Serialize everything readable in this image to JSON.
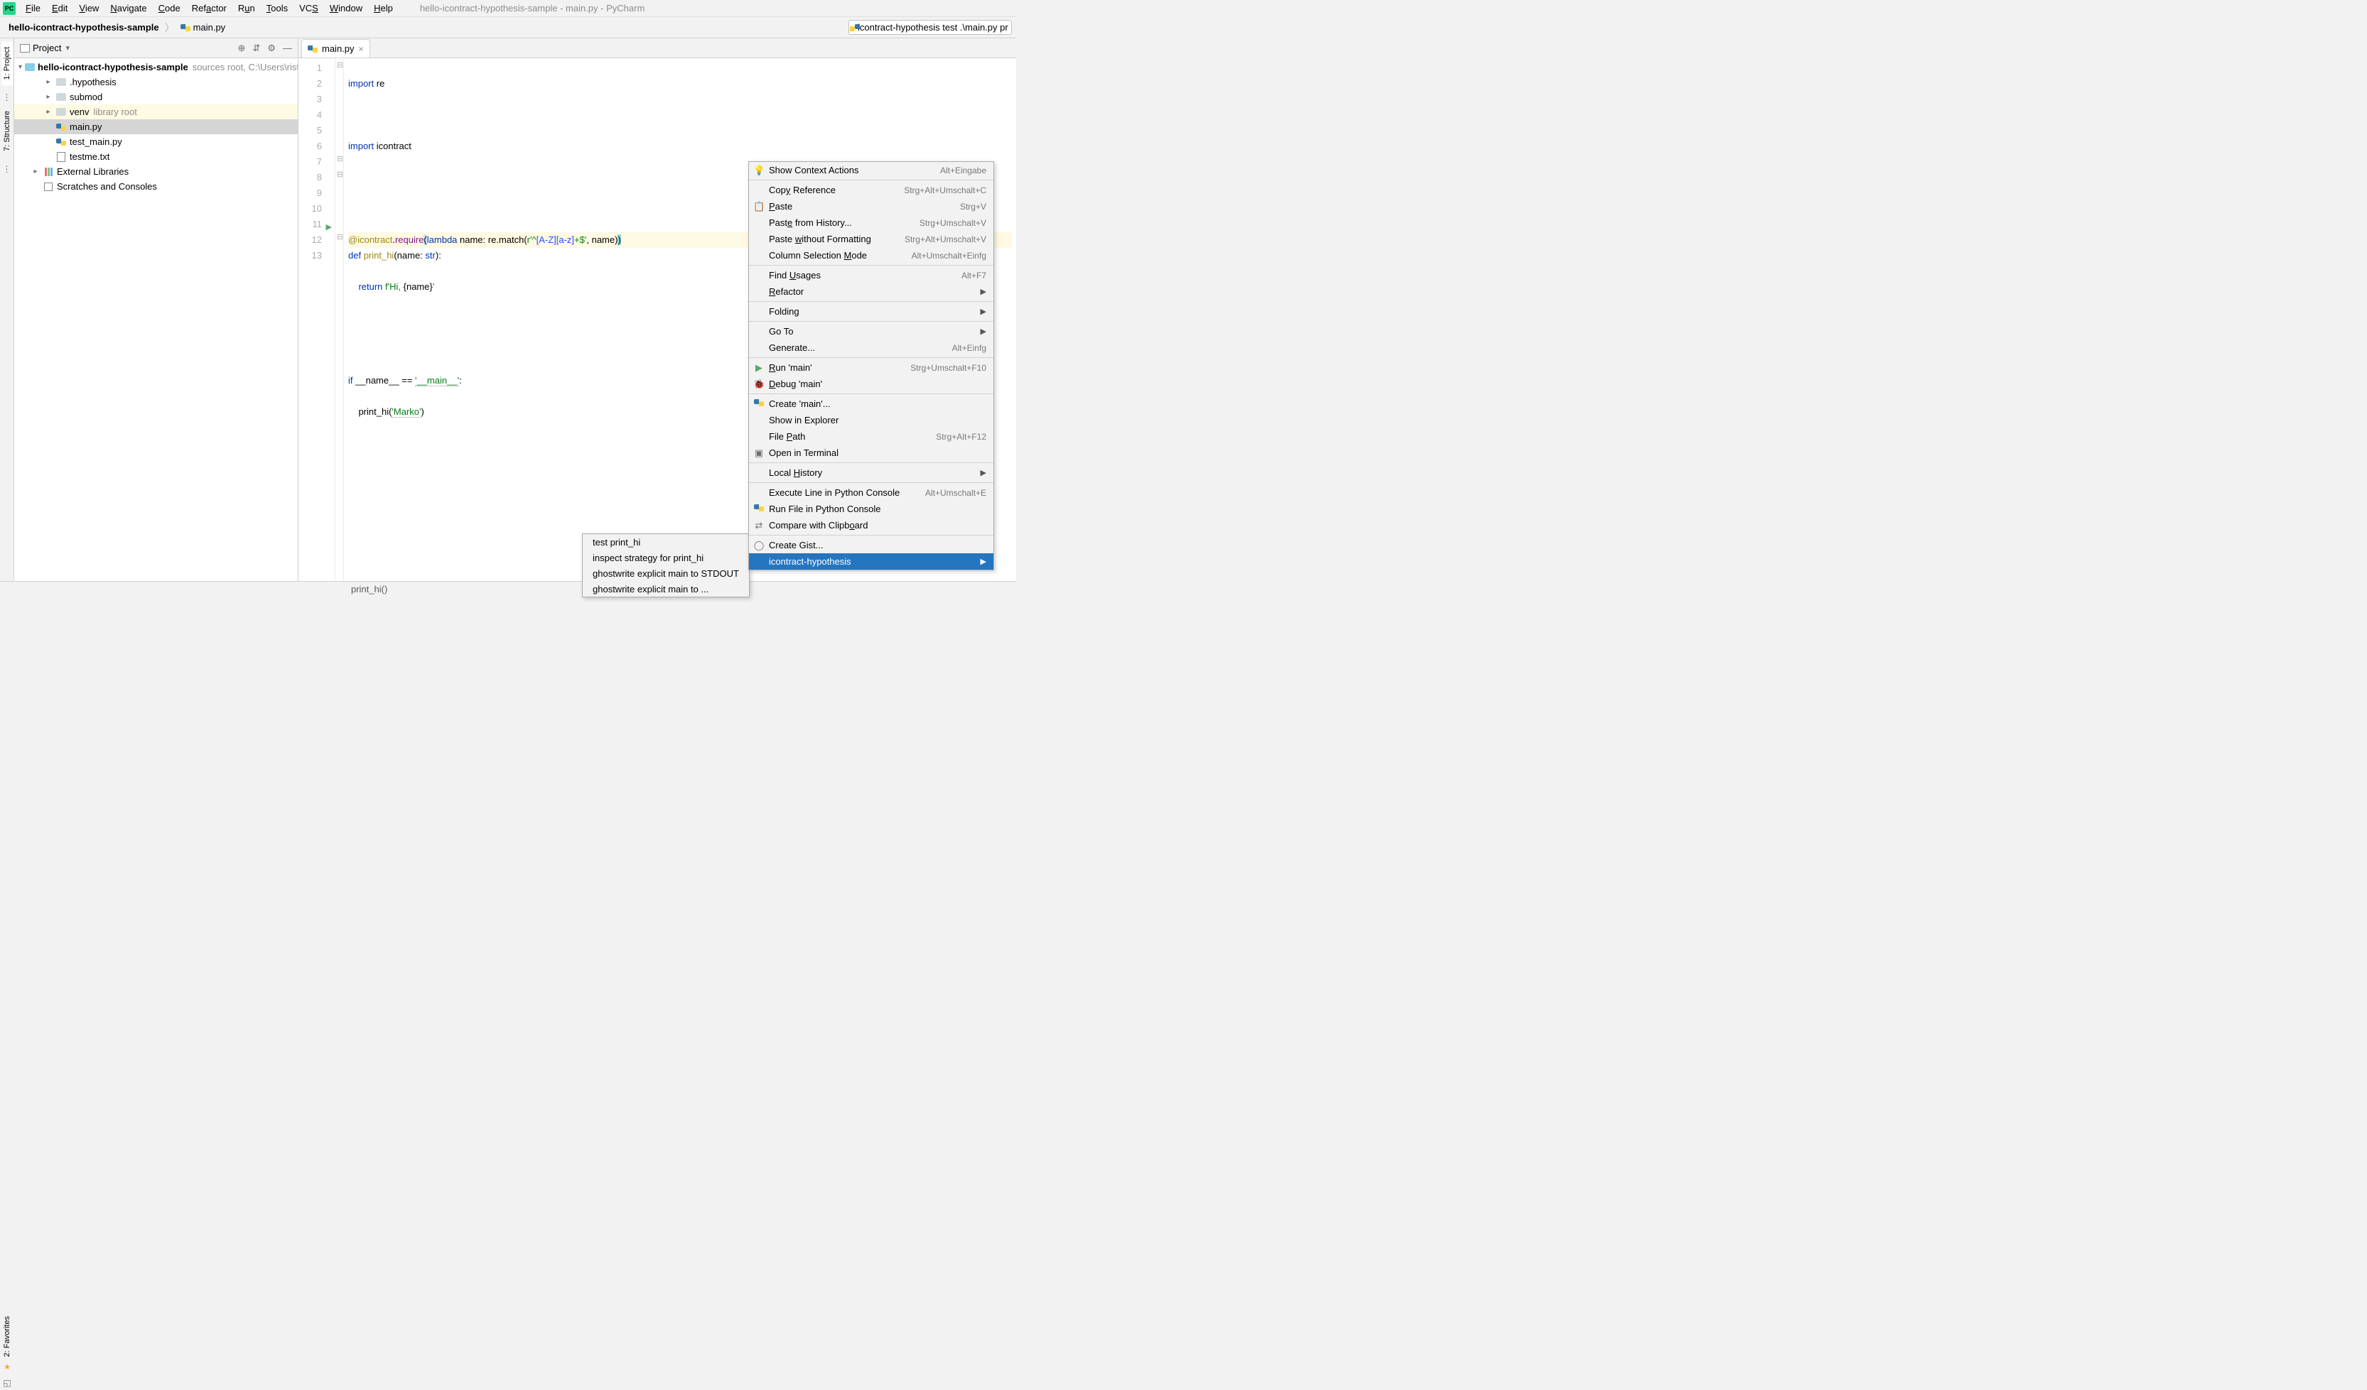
{
  "menubar": {
    "items": [
      "File",
      "Edit",
      "View",
      "Navigate",
      "Code",
      "Refactor",
      "Run",
      "Tools",
      "VCS",
      "Window",
      "Help"
    ],
    "underlines": [
      0,
      0,
      0,
      0,
      0,
      3,
      1,
      0,
      2,
      0,
      0
    ],
    "title": "hello-icontract-hypothesis-sample - main.py - PyCharm"
  },
  "breadcrumb": {
    "project": "hello-icontract-hypothesis-sample",
    "file": "main.py",
    "runconfig": "icontract-hypothesis test .\\main.py pr"
  },
  "left_tabs": {
    "project": "1: Project",
    "structure": "7: Structure",
    "favorites": "2: Favorites"
  },
  "project_panel": {
    "title": "Project",
    "root": "hello-icontract-hypothesis-sample",
    "root_meta": "sources root,  C:\\Users\\rist",
    "items": [
      {
        "name": ".hypothesis",
        "kind": "folder"
      },
      {
        "name": "submod",
        "kind": "folder"
      },
      {
        "name": "venv",
        "kind": "folder",
        "meta": "library root",
        "hl": true
      },
      {
        "name": "main.py",
        "kind": "py",
        "selected": true
      },
      {
        "name": "test_main.py",
        "kind": "py"
      },
      {
        "name": "testme.txt",
        "kind": "txt"
      }
    ],
    "external": "External Libraries",
    "scratches": "Scratches and Consoles"
  },
  "tab": {
    "name": "main.py"
  },
  "code_lines": [
    1,
    2,
    3,
    4,
    5,
    6,
    7,
    8,
    9,
    10,
    11,
    12,
    13
  ],
  "code": {
    "l1a": "import",
    "l1b": " re",
    "l3a": "import",
    "l3b": " icontract",
    "l6a": "@icontract",
    "l6b": ".",
    "l6c": "require",
    "l6d": "(",
    "l6e": "lambda",
    "l6f": " name: re.match(",
    "l6g": "r'^",
    "l6h": "[A-Z][a-z]",
    "l6i": "+$'",
    "l6j": ", name)",
    "l6k": ")",
    "l7a": "def ",
    "l7b": "print_hi",
    "l7c": "(name: ",
    "l7d": "str",
    "l7e": "):",
    "l8a": "    ",
    "l8b": "return ",
    "l8c": "f'Hi, ",
    "l8d": "{",
    "l8e": "name",
    "l8f": "}",
    "l8g": "'",
    "l11a": "if ",
    "l11b": "__name__ == ",
    "l11c": "'__main__'",
    "l11d": ":",
    "l12a": "    print_hi(",
    "l12b": "'Marko'",
    "l12c": ")"
  },
  "context_menu": [
    {
      "label": "Show Context Actions",
      "shortcut": "Alt+Eingabe",
      "icon": "💡"
    },
    {
      "sep": true
    },
    {
      "label": "Copy Reference",
      "u": 3,
      "shortcut": "Strg+Alt+Umschalt+C"
    },
    {
      "label": "Paste",
      "u": 0,
      "shortcut": "Strg+V",
      "icon": "📋"
    },
    {
      "label": "Paste from History...",
      "u": 4,
      "shortcut": "Strg+Umschalt+V"
    },
    {
      "label": "Paste without Formatting",
      "u": 6,
      "shortcut": "Strg+Alt+Umschalt+V"
    },
    {
      "label": "Column Selection Mode",
      "u": 17,
      "shortcut": "Alt+Umschalt+Einfg"
    },
    {
      "sep": true
    },
    {
      "label": "Find Usages",
      "u": 5,
      "shortcut": "Alt+F7"
    },
    {
      "label": "Refactor",
      "u": 0,
      "submenu": true
    },
    {
      "sep": true
    },
    {
      "label": "Folding",
      "submenu": true
    },
    {
      "sep": true
    },
    {
      "label": "Go To",
      "submenu": true
    },
    {
      "label": "Generate...",
      "shortcut": "Alt+Einfg"
    },
    {
      "sep": true
    },
    {
      "label": "Run 'main'",
      "u": 0,
      "shortcut": "Strg+Umschalt+F10",
      "icon": "▶",
      "iconColor": "#59a869"
    },
    {
      "label": "Debug 'main'",
      "u": 0,
      "icon": "🐞",
      "iconColor": "#59a869"
    },
    {
      "sep": true
    },
    {
      "label": "Create 'main'...",
      "icon": "py"
    },
    {
      "label": "Show in Explorer"
    },
    {
      "label": "File Path",
      "u": 5,
      "shortcut": "Strg+Alt+F12"
    },
    {
      "label": "Open in Terminal",
      "icon": "▣"
    },
    {
      "sep": true
    },
    {
      "label": "Local History",
      "u": 6,
      "submenu": true
    },
    {
      "sep": true
    },
    {
      "label": "Execute Line in Python Console",
      "shortcut": "Alt+Umschalt+E"
    },
    {
      "label": "Run File in Python Console",
      "icon": "py"
    },
    {
      "label": "Compare with Clipboard",
      "u": 18,
      "icon": "⇄"
    },
    {
      "sep": true
    },
    {
      "label": "Create Gist...",
      "icon": "◯"
    },
    {
      "label": "icontract-hypothesis",
      "submenu": true,
      "selected": true
    }
  ],
  "submenu": [
    "test print_hi",
    "inspect strategy for print_hi",
    "ghostwrite explicit main to STDOUT",
    "ghostwrite explicit main to ..."
  ],
  "status": {
    "breadcrumb": "print_hi()"
  }
}
